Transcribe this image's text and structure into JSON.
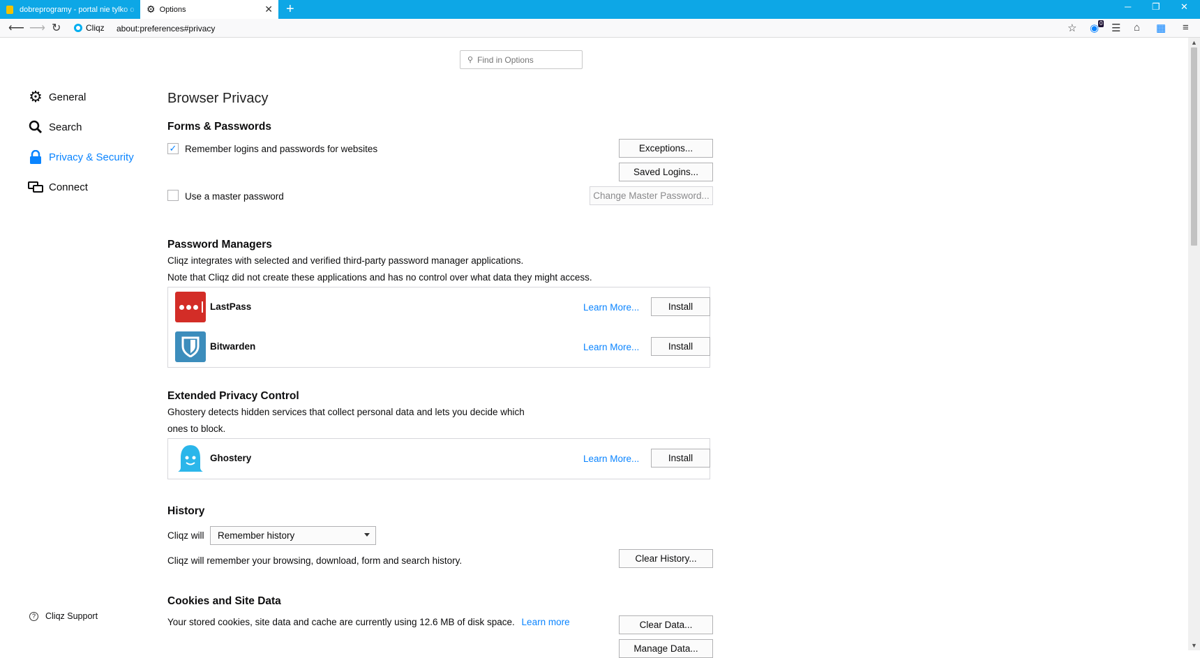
{
  "tabs": [
    {
      "label": "dobreprogramy - portal nie tylko o",
      "icon": "dobreprogramy-favicon"
    },
    {
      "label": "Options",
      "icon": "gear-icon",
      "active": true
    }
  ],
  "navbar": {
    "identity_label": "Cliqz",
    "url": "about:preferences#privacy",
    "ghostery_badge": "0"
  },
  "search": {
    "placeholder": "Find in Options"
  },
  "categories": [
    {
      "label": "General",
      "icon": "gear-icon"
    },
    {
      "label": "Search",
      "icon": "search-icon"
    },
    {
      "label": "Privacy & Security",
      "icon": "lock-icon",
      "selected": true
    },
    {
      "label": "Connect",
      "icon": "connect-icon"
    }
  ],
  "support": {
    "label": "Cliqz Support"
  },
  "page": {
    "title": "Browser Privacy",
    "forms": {
      "heading": "Forms & Passwords",
      "remember_label": "Remember logins and passwords for websites",
      "remember_checked": true,
      "exceptions": "Exceptions...",
      "saved_logins": "Saved Logins...",
      "master_label": "Use a master password",
      "master_checked": false,
      "change_master": "Change Master Password..."
    },
    "password_managers": {
      "heading": "Password Managers",
      "desc1": "Cliqz integrates with selected and verified third-party password manager applications.",
      "desc2": "Note that Cliqz did not create these applications and has no control over what data they might access.",
      "items": [
        {
          "name": "LastPass",
          "learn": "Learn More...",
          "install": "Install"
        },
        {
          "name": "Bitwarden",
          "learn": "Learn More...",
          "install": "Install"
        }
      ]
    },
    "epc": {
      "heading": "Extended Privacy Control",
      "desc1": "Ghostery detects hidden services that collect personal data and lets you decide which",
      "desc2": "ones to block.",
      "item": {
        "name": "Ghostery",
        "learn": "Learn More...",
        "install": "Install"
      }
    },
    "history": {
      "heading": "History",
      "will_label": "Cliqz will",
      "select_value": "Remember history",
      "desc": "Cliqz will remember your browsing, download, form and search history.",
      "clear": "Clear History..."
    },
    "cookies": {
      "heading": "Cookies and Site Data",
      "desc": "Your stored cookies, site data and cache are currently using 12.6 MB of disk space.",
      "learn": "Learn more",
      "clear_data": "Clear Data...",
      "manage_data": "Manage Data..."
    }
  }
}
